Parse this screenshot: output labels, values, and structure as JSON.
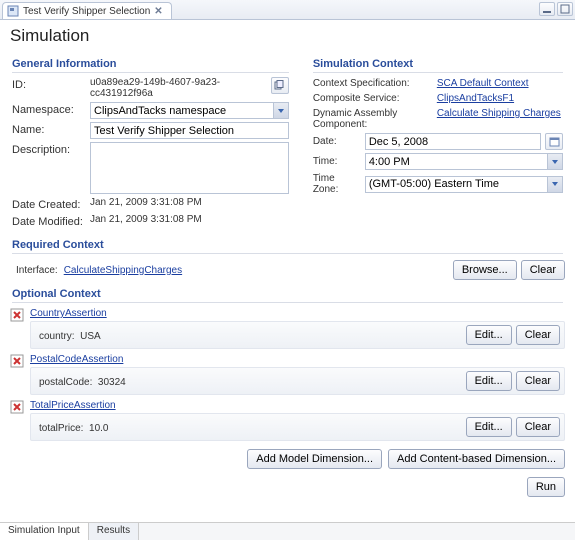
{
  "tab": {
    "title": "Test Verify Shipper Selection"
  },
  "page": {
    "title": "Simulation"
  },
  "general": {
    "header": "General Information",
    "labels": {
      "id": "ID:",
      "namespace": "Namespace:",
      "name": "Name:",
      "description": "Description:",
      "date_created": "Date Created:",
      "date_modified": "Date Modified:"
    },
    "id": "u0a89ea29-149b-4607-9a23-cc431912f96a",
    "namespace": "ClipsAndTacks namespace",
    "name": "Test Verify Shipper Selection",
    "description": "",
    "date_created": "Jan 21, 2009 3:31:08 PM",
    "date_modified": "Jan 21, 2009 3:31:08 PM"
  },
  "context": {
    "header": "Simulation Context",
    "labels": {
      "context_spec": "Context Specification:",
      "composite_service": "Composite Service:",
      "dynamic_assembly": "Dynamic Assembly Component:",
      "date": "Date:",
      "time": "Time:",
      "timezone": "Time Zone:"
    },
    "context_spec": "SCA Default Context",
    "composite_service": "ClipsAndTacksF1",
    "dynamic_assembly": "Calculate Shipping Charges",
    "date": "Dec 5, 2008",
    "time": "4:00 PM",
    "timezone": "(GMT-05:00) Eastern Time"
  },
  "required": {
    "header": "Required Context",
    "interface_label": "Interface:",
    "interface_value": "CalculateShippingCharges",
    "browse": "Browse...",
    "clear": "Clear"
  },
  "optional": {
    "header": "Optional Context",
    "edit": "Edit...",
    "clear": "Clear",
    "assertions": [
      {
        "name": "CountryAssertion",
        "key": "country:",
        "value": "USA"
      },
      {
        "name": "PostalCodeAssertion",
        "key": "postalCode:",
        "value": "30324"
      },
      {
        "name": "TotalPriceAssertion",
        "key": "totalPrice:",
        "value": "10.0"
      }
    ]
  },
  "buttons": {
    "add_model_dimension": "Add Model Dimension...",
    "add_content_dimension": "Add Content-based Dimension...",
    "run": "Run"
  },
  "footer": {
    "tab1": "Simulation Input",
    "tab2": "Results"
  }
}
